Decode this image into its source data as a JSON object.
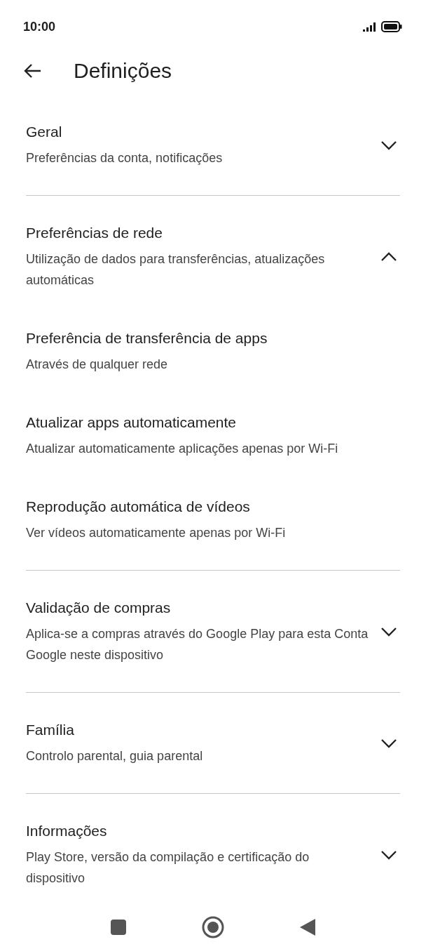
{
  "status_bar": {
    "time": "10:00"
  },
  "header": {
    "title": "Definições"
  },
  "sections": [
    {
      "title": "Geral",
      "subtitle": "Preferências da conta, notificações",
      "expanded": false
    },
    {
      "title": "Preferências de rede",
      "subtitle": "Utilização de dados para transferências, atualizações automáticas",
      "expanded": true,
      "children": [
        {
          "title": "Preferência de transferência de apps",
          "subtitle": "Através de qualquer rede"
        },
        {
          "title": "Atualizar apps automaticamente",
          "subtitle": "Atualizar automaticamente aplicações apenas por Wi-Fi"
        },
        {
          "title": "Reprodução automática de vídeos",
          "subtitle": "Ver vídeos automaticamente apenas por Wi-Fi"
        }
      ]
    },
    {
      "title": "Validação de compras",
      "subtitle": "Aplica-se a compras através do Google Play para esta Conta Google neste dispositivo",
      "expanded": false
    },
    {
      "title": "Família",
      "subtitle": "Controlo parental, guia parental",
      "expanded": false
    },
    {
      "title": "Informações",
      "subtitle": "Play Store, versão da compilação e certificação do dispositivo",
      "expanded": false
    }
  ]
}
